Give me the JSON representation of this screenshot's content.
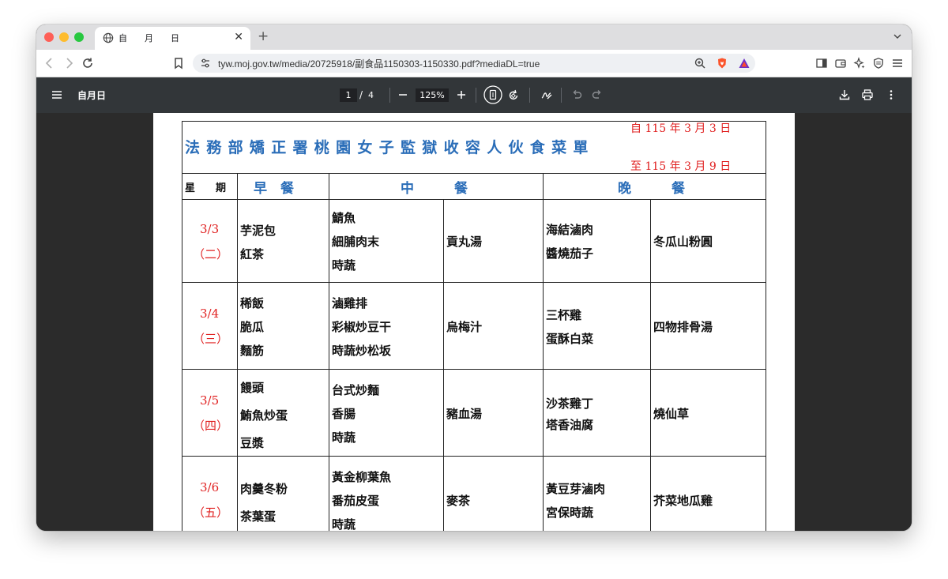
{
  "browser": {
    "tab_title": "自　　月　　日",
    "url": "tyw.moj.gov.tw/media/20725918/副食品1150303-1150330.pdf?mediaDL=true"
  },
  "pdf_toolbar": {
    "doc_title": "自月日",
    "current_page": "1",
    "page_separator": "/",
    "total_pages": "4",
    "zoom": "125%"
  },
  "menu": {
    "title": "法務部矯正署桃園女子監獄收容人伙食菜單",
    "date_from": "自 115 年 3 月 3 日",
    "date_to": "至 115 年 3 月 9 日",
    "headers": {
      "weekday": "星　　期",
      "breakfast": "早　餐",
      "lunch": "中　　　餐",
      "dinner": "晚　　　餐"
    },
    "days": [
      {
        "date": "3/3",
        "weekday": "（二）",
        "breakfast": [
          "芋泥包",
          "紅茶"
        ],
        "lunch_main": [
          "鯖魚",
          "細脯肉末",
          "時蔬"
        ],
        "lunch_soup": [
          "貢丸湯"
        ],
        "dinner_main": [
          "海結滷肉",
          "醬燒茄子"
        ],
        "dinner_soup": [
          "冬瓜山粉圓"
        ]
      },
      {
        "date": "3/4",
        "weekday": "（三）",
        "breakfast": [
          "稀飯",
          "脆瓜",
          "麵筋"
        ],
        "lunch_main": [
          "滷雞排",
          "彩椒炒豆干",
          "時蔬炒松坂"
        ],
        "lunch_soup": [
          "烏梅汁"
        ],
        "dinner_main": [
          "三杯雞",
          "蛋酥白菜"
        ],
        "dinner_soup": [
          "四物排骨湯"
        ]
      },
      {
        "date": "3/5",
        "weekday": "（四）",
        "breakfast": [
          "饅頭",
          "鮪魚炒蛋",
          "豆漿"
        ],
        "lunch_main": [
          "台式炒麵",
          "香腸",
          "時蔬"
        ],
        "lunch_soup": [
          "豬血湯"
        ],
        "dinner_main": [
          "沙茶雞丁",
          "塔香油腐"
        ],
        "dinner_soup": [
          "燒仙草"
        ]
      },
      {
        "date": "3/6",
        "weekday": "（五）",
        "breakfast": [
          "肉羹冬粉",
          "茶葉蛋"
        ],
        "lunch_main": [
          "黃金柳葉魚",
          "番茄皮蛋",
          "時蔬"
        ],
        "lunch_soup": [
          "麥茶"
        ],
        "dinner_main": [
          "黃豆芽滷肉",
          "宮保時蔬"
        ],
        "dinner_soup": [
          "芥菜地瓜雞"
        ]
      }
    ]
  }
}
